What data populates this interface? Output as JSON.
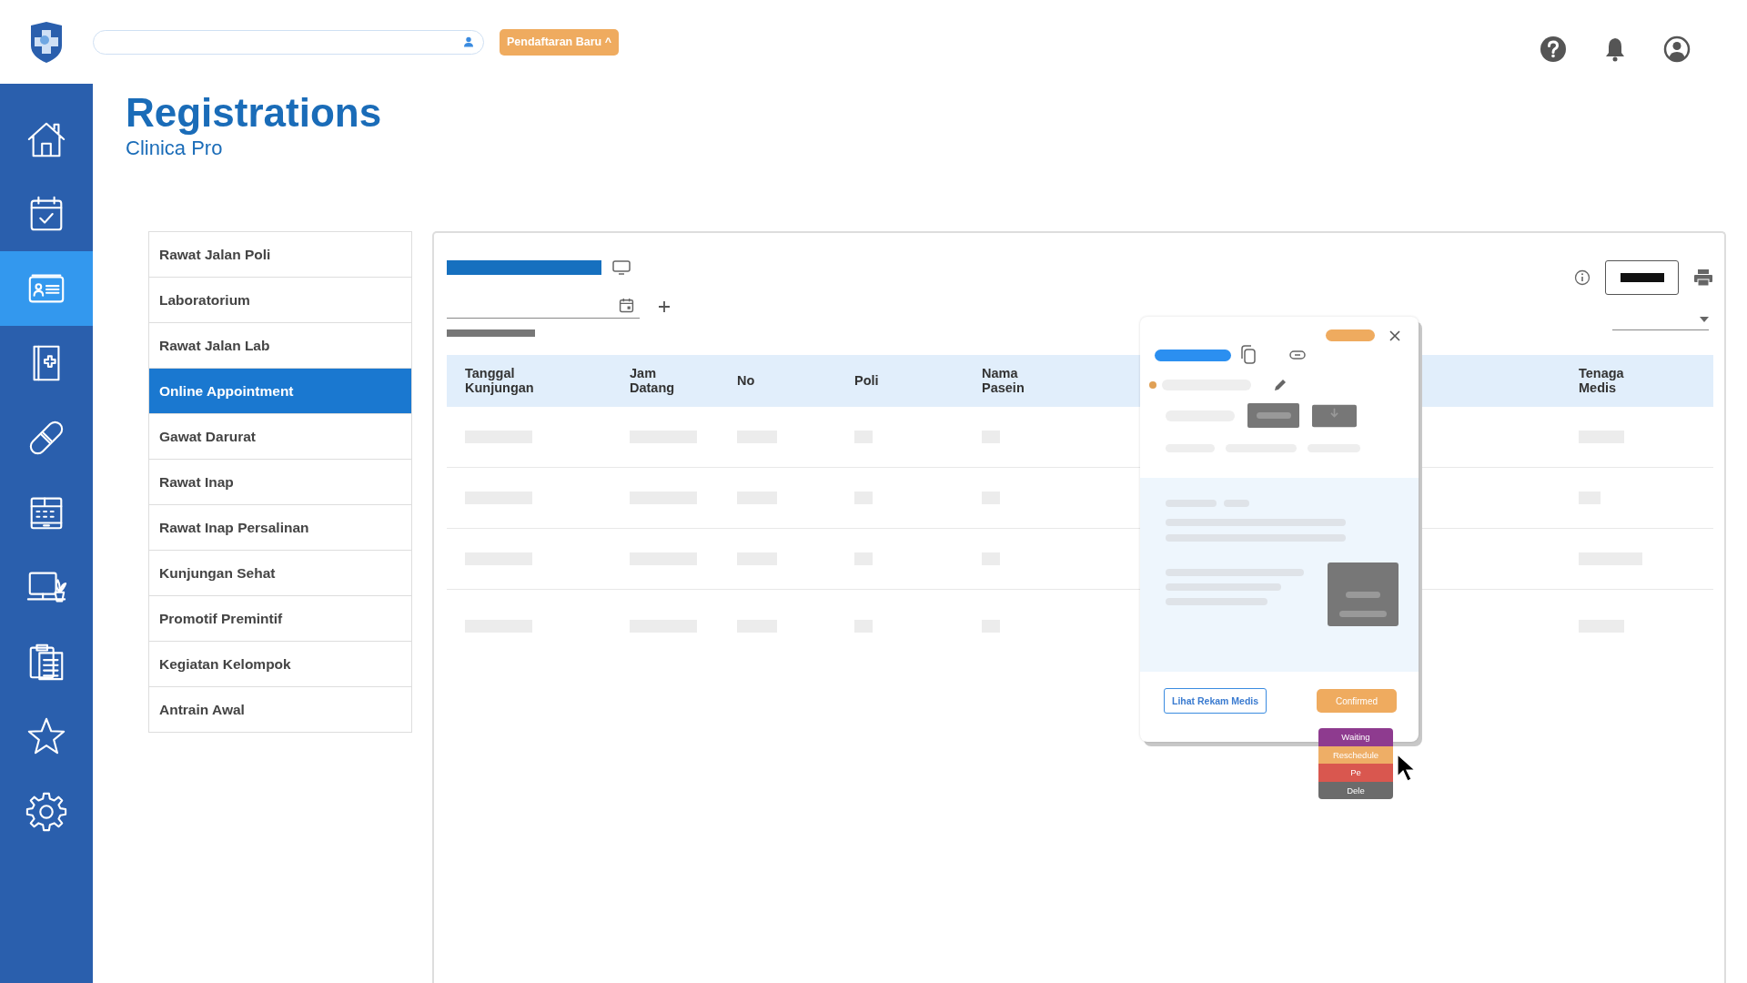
{
  "topbar": {
    "new_button": "Pendaftaran Baru ^"
  },
  "sidebar": {
    "items": [
      {
        "kind": "home",
        "selected": false
      },
      {
        "kind": "calendar",
        "selected": false
      },
      {
        "kind": "id-card",
        "selected": true
      },
      {
        "kind": "book",
        "selected": false
      },
      {
        "kind": "bandage",
        "selected": false
      },
      {
        "kind": "register",
        "selected": false
      },
      {
        "kind": "monitor",
        "selected": false
      },
      {
        "kind": "clipboard",
        "selected": false
      },
      {
        "kind": "star",
        "selected": false
      },
      {
        "kind": "settings",
        "selected": false
      }
    ]
  },
  "page": {
    "title": "Registrations",
    "subtitle": "Clinica Pro"
  },
  "menu": [
    {
      "label": "Rawat Jalan Poli",
      "selected": false
    },
    {
      "label": "Laboratorium",
      "selected": false
    },
    {
      "label": "Rawat Jalan Lab",
      "selected": false
    },
    {
      "label": "Online Appointment",
      "selected": true
    },
    {
      "label": "Gawat Darurat",
      "selected": false
    },
    {
      "label": "Rawat Inap",
      "selected": false
    },
    {
      "label": "Rawat Inap Persalinan",
      "selected": false
    },
    {
      "label": "Kunjungan Sehat",
      "selected": false
    },
    {
      "label": "Promotif Premintif",
      "selected": false
    },
    {
      "label": "Kegiatan Kelompok",
      "selected": false
    },
    {
      "label": "Antrain Awal",
      "selected": false
    }
  ],
  "table": {
    "columns": [
      "Tanggal\nKunjungan",
      "Jam\nDatang",
      "No",
      "Poli",
      "Nama\nPasein",
      "Tenaga\nMedis"
    ]
  },
  "popup": {
    "record_button": "Lihat Rekam Medis",
    "status_button": "Confirmed",
    "status_options": [
      {
        "label": "Waiting",
        "color": "#8e3b8f"
      },
      {
        "label": "Reschedule",
        "color": "#eeae66"
      },
      {
        "label": "Pe",
        "color": "#d9574f"
      },
      {
        "label": "Dele",
        "color": "#6b6b6b"
      }
    ]
  }
}
